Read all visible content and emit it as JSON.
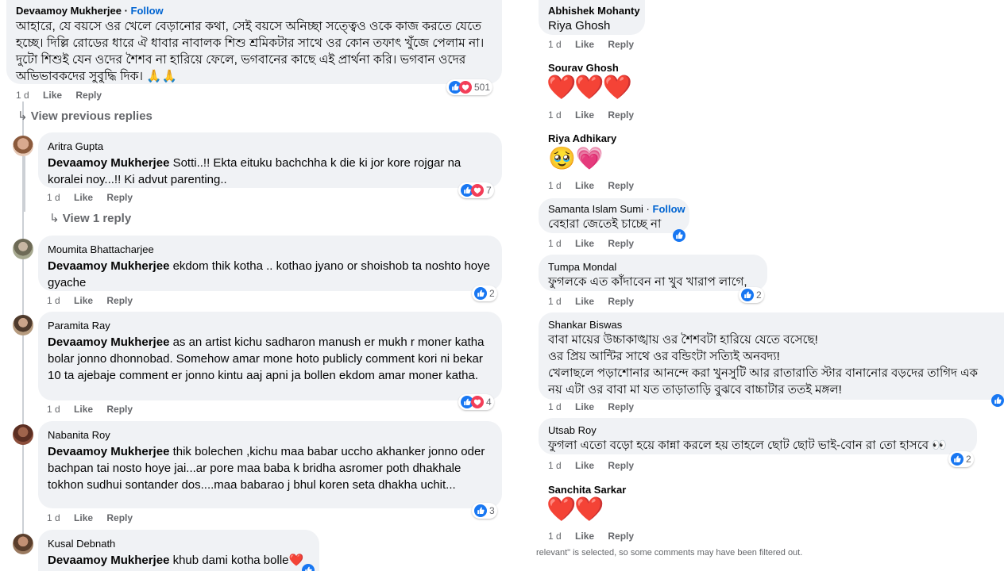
{
  "common": {
    "like": "Like",
    "reply": "Reply",
    "time": "1 d"
  },
  "left": {
    "top_comment": {
      "author": "Devaamoy Mukherjee",
      "dot": " · ",
      "follow": "Follow",
      "text": "আহারে, যে বয়সে ওর খেলে বেড়ানোর কথা, সেই বয়সে অনিচ্ছা সত্ত্বেও ওকে কাজ করতে যেতে হচ্ছে। দিল্লি রোডের ধারে ঐ ধাবার নাবালক শিশু শ্রমিকটার সাথে ওর কোন তফাৎ খুঁজে পেলাম না। দুটো শিশুই যেন ওদের শৈশব না হারিয়ে ফেলে, ভগবানের কাছে এই প্রার্থনা করি। ভগবান ওদের অভিভাবকদের সুবুদ্ধি দিক। 🙏🙏",
      "reactions": "501"
    },
    "view_previous": "View previous replies",
    "view_one_reply": "View 1 reply",
    "replies": [
      {
        "author": "Aritra Gupta",
        "mention": "Devaamoy Mukherjee",
        "text": " Sotti..!! Ekta eituku bachchha k die ki jor kore rojgar na koralei noy...!! Ki advut parenting..",
        "reactions": "7"
      },
      {
        "author": "Moumita Bhattacharjee",
        "mention": "Devaamoy Mukherjee",
        "text": " ekdom thik kotha .. kothao jyano or shoishob ta noshto hoye gyache",
        "reactions": "2"
      },
      {
        "author": "Paramita Ray",
        "mention": "Devaamoy Mukherjee",
        "text": " as an artist kichu sadharon manush er mukh r moner katha bolar jonno dhonnobad. Somehow amar mone hoto publicly comment kori ni bekar 10 ta ajebaje comment er jonno kintu aaj apni ja bollen ekdom amar moner katha.",
        "reactions": "4"
      },
      {
        "author": "Nabanita Roy",
        "mention": "Devaamoy Mukherjee",
        "text": " thik bolechen ,kichu maa babar uccho akhanker jonno oder bachpan tai nosto hoye jai...ar pore maa baba k bridha asromer poth dhakhale tokhon sudhui sontander dos....maa babarao j bhul koren seta dhakha uchit...",
        "reactions": "3"
      },
      {
        "author": "Kusal Debnath",
        "mention": "Devaamoy Mukherjee",
        "text": " khub dami kotha bolle❤️",
        "reactions": ""
      }
    ]
  },
  "right": {
    "comments": [
      {
        "author": "Abhishek Mohanty",
        "text": "Riya Ghosh",
        "reactions": ""
      },
      {
        "author": "Sourav Ghosh",
        "text": "❤️❤️❤️",
        "reactions": ""
      },
      {
        "author": "Riya Adhikary",
        "text": "🥹💗",
        "reactions": ""
      },
      {
        "author": "Samanta Islam Sumi",
        "follow": "Follow",
        "dot": " · ",
        "text": "বেহারা জেতেই চাচ্ছে না",
        "reactions": ""
      },
      {
        "author": "Tumpa Mondal",
        "text": "ফুগলকে এত কাঁদাবেন না খুব খারাপ লাগে,",
        "reactions": "2"
      },
      {
        "author": "Shankar Biswas",
        "text_lines": [
          "বাবা মায়ের উচ্চাকাঙ্খায় ওর শৈশবটা হারিয়ে যেতে বসেছে!",
          "ওর প্রিয় আন্টির সাথে ওর বন্ডিংটা সত্যিই অনবদ্য!",
          "খেলাছলে পড়াশোনার আনন্দে করা খুনসুটি আর রাতারাতি স্টার বানানোর বড়দের তাগিদ এক",
          "নয় এটা ওর বাবা মা যত তাড়াতাড়ি বুঝবে বাচ্চাটার ততই মঙ্গল!"
        ],
        "reactions": ""
      },
      {
        "author": "Utsab Roy",
        "text": "ফুগলা এতো বড়ো হয়ে কান্না করলে হয় তাহলে ছোট ছোট ভাই-বোন রা তো হাসবে 👀",
        "reactions": "2"
      },
      {
        "author": "Sanchita Sarkar",
        "text": "❤️❤️",
        "reactions": ""
      }
    ],
    "footnote": "relevant\" is selected, so some comments may have been filtered out."
  },
  "colors": {
    "bubble": "#f0f2f5",
    "like_blue": "#1877f2",
    "love_red": "#f33e58",
    "meta": "#65676b",
    "follow": "#0064d1"
  }
}
